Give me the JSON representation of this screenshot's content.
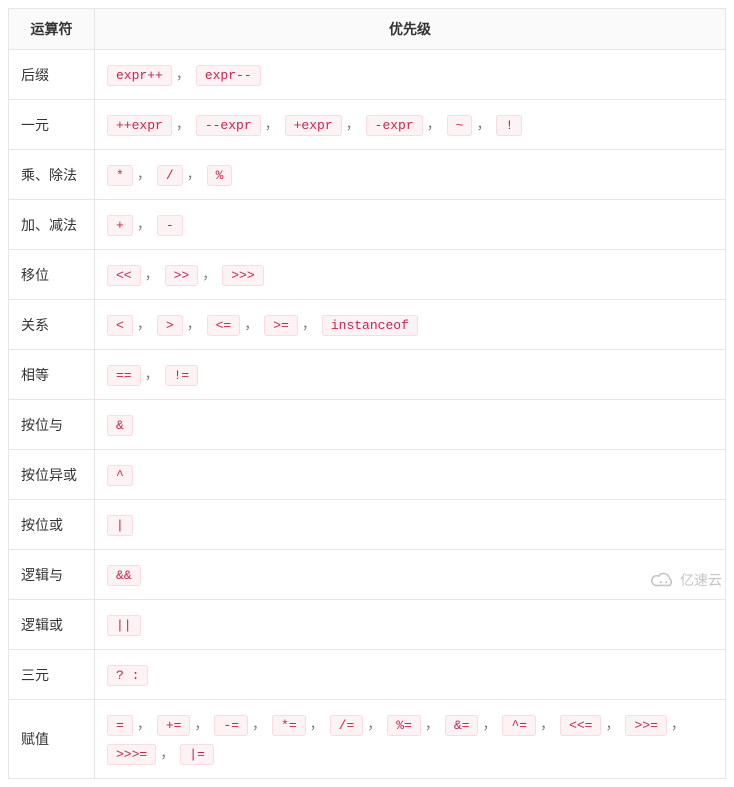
{
  "table": {
    "headers": [
      "运算符",
      "优先级"
    ],
    "rows": [
      {
        "category": "后缀",
        "operators": [
          "expr++",
          "expr--"
        ]
      },
      {
        "category": "一元",
        "operators": [
          "++expr",
          "--expr",
          "+expr",
          "-expr",
          "~",
          "!"
        ]
      },
      {
        "category": "乘、除法",
        "operators": [
          "*",
          "/",
          "%"
        ]
      },
      {
        "category": "加、减法",
        "operators": [
          "+",
          "-"
        ]
      },
      {
        "category": "移位",
        "operators": [
          "<<",
          ">>",
          ">>>"
        ]
      },
      {
        "category": "关系",
        "operators": [
          "<",
          ">",
          "<=",
          ">=",
          "instanceof"
        ]
      },
      {
        "category": "相等",
        "operators": [
          "==",
          "!="
        ]
      },
      {
        "category": "按位与",
        "operators": [
          "&"
        ]
      },
      {
        "category": "按位异或",
        "operators": [
          "^"
        ]
      },
      {
        "category": "按位或",
        "operators": [
          "|"
        ]
      },
      {
        "category": "逻辑与",
        "operators": [
          "&&"
        ]
      },
      {
        "category": "逻辑或",
        "operators": [
          "||"
        ]
      },
      {
        "category": "三元",
        "operators": [
          "? :"
        ]
      },
      {
        "category": "赋值",
        "operators": [
          "=",
          "+=",
          "-=",
          "*=",
          "/=",
          "%=",
          "&=",
          "^=",
          "<<=",
          ">>=",
          ">>>=",
          "|="
        ]
      }
    ],
    "separator": "，"
  },
  "watermark": {
    "text": "亿速云"
  }
}
